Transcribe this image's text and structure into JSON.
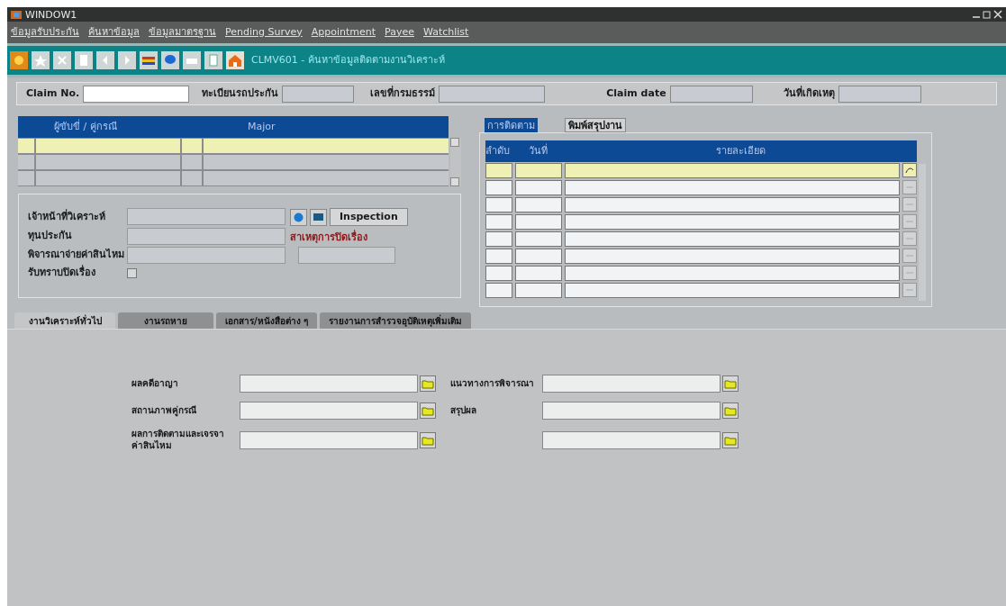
{
  "window": {
    "title": "WINDOW1"
  },
  "menu": [
    "ข้อมูลรับประกัน",
    "ค้นหาข้อมูล",
    "ข้อมูลมาตรฐาน",
    "Pending Survey",
    "Appointment",
    "Payee",
    "Watchlist"
  ],
  "toolbar": {
    "title": "CLMV601 - ค้นหาข้อมูลติดตามงานวิเคราะห์"
  },
  "header_fields": [
    {
      "label": "Claim No.",
      "editable": true
    },
    {
      "label": "ทะเบียนรถประกัน",
      "editable": false
    },
    {
      "label": "เลขที่กรมธรรม์",
      "editable": false
    },
    {
      "label": "Claim date",
      "editable": false
    },
    {
      "label": "วันที่เกิดเหตุ",
      "editable": false
    }
  ],
  "party_grid": {
    "columns": [
      "ผู้ขับขี่ / คู่กรณี",
      "Major"
    ],
    "rows": [
      {
        "selected": true
      },
      {
        "selected": false
      },
      {
        "selected": false
      }
    ]
  },
  "analysis": {
    "analyst_label": "เจ้าหน้าที่วิเคราะห์",
    "inspection_button": "Inspection",
    "sum_insured_label": "ทุนประกัน",
    "close_reason_label": "สาเหตุการปิดเรื่อง",
    "pay_claim_label": "พิจารณาจ่ายค่าสินไหม",
    "acknowledge": {
      "label": "รับทราบปิดเรื่อง",
      "checked": false
    }
  },
  "follow_tabs": [
    {
      "label": "การติดตาม",
      "selected": true
    },
    {
      "label": "พิมพ์สรุปงาน",
      "selected": false
    }
  ],
  "follow_grid": {
    "columns": [
      "ลำดับ",
      "วันที่",
      "รายละเอียด"
    ],
    "rows": [
      {
        "selected": true
      },
      {
        "selected": false
      },
      {
        "selected": false
      },
      {
        "selected": false
      },
      {
        "selected": false
      },
      {
        "selected": false
      },
      {
        "selected": false
      },
      {
        "selected": false
      }
    ]
  },
  "tabs": [
    {
      "label": "งานวิเคราะห์ทั่วไป",
      "selected": true
    },
    {
      "label": "งานรถหาย",
      "selected": false
    },
    {
      "label": "เอกสาร/หนังสือต่าง ๆ",
      "selected": false
    },
    {
      "label": "รายงานการสำรวจอุบัติเหตุเพิ่มเติม",
      "selected": false
    }
  ],
  "general_fields": [
    {
      "kind": "labeled",
      "label": "ผลคดีอาญา"
    },
    {
      "kind": "labeled",
      "label": "แนวทางการพิจารณา"
    },
    {
      "kind": "labeled",
      "label": "สถานภาพคู่กรณี"
    },
    {
      "kind": "labeled",
      "label": "สรุปผล"
    },
    {
      "kind": "labeled",
      "label": "ผลการติดตามและเจรจาค่าสินไหม"
    },
    {
      "kind": "unlabeled"
    }
  ]
}
